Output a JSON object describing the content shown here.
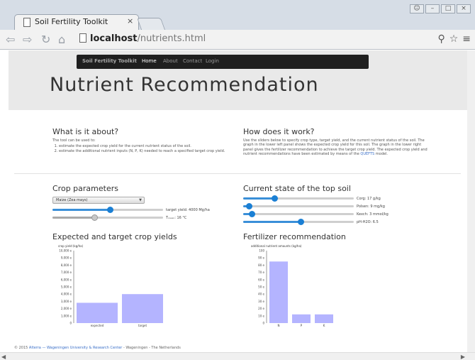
{
  "browser": {
    "tab_title": "Soil Fertility Toolkit",
    "tab_close": "×",
    "url_host": "localhost",
    "url_path": "/nutrients.html"
  },
  "site_nav": {
    "brand": "Soil Fertility Toolkit",
    "items": [
      "Home",
      "About",
      "Contact",
      "Login"
    ],
    "active_index": 0
  },
  "page_title": "Nutrient Recommendation",
  "about": {
    "heading": "What is it about?",
    "intro": "The tool can be used to:",
    "items": [
      "estimate the expected crop yield for the current nutrient status of the soil.",
      "estimate the additional nutrient inputs (N, P, K) needed to reach a specified target crop yield."
    ]
  },
  "how": {
    "heading": "How does it work?",
    "text": "Use the sliders below to specify crop type, target yield, and the current nutrient status of the soil. The graph in the lower left panel shows the expected crop yield for this soil. The graph in the lower right panel gives the fertilizer recommendation to achieve the target crop yield. The expected crop yield and nutrient recommendations have been estimated by means of the",
    "model_link": "QUEFTS",
    "text_end": "model."
  },
  "crop": {
    "heading": "Crop parameters",
    "select_value": "Maize (Zea mays)",
    "target_yield_label": "target yield: 4000 Mg/ha",
    "target_yield_fraction": 0.52,
    "tmean_label": "Tₘₑₐₙ: 16 °C",
    "tmean_fraction": 0.38
  },
  "soil": {
    "heading": "Current state of the top soil",
    "sliders": [
      {
        "label": "Corg: 17 g/kg",
        "fraction": 0.28
      },
      {
        "label": "Polsen: 9 mg/kg",
        "fraction": 0.05
      },
      {
        "label": "Kexch: 3 mmol/kg",
        "fraction": 0.08
      },
      {
        "label": "pH-H2O: 6.5",
        "fraction": 0.52
      }
    ]
  },
  "yields_panel": {
    "heading": "Expected and target crop yields"
  },
  "fert_panel": {
    "heading": "Fertilizer recommendation"
  },
  "chart_data": [
    {
      "type": "bar",
      "title": "Expected and target crop yields",
      "ylabel": "crop yield (kg/ha)",
      "categories": [
        "expected",
        "target"
      ],
      "values": [
        2800,
        4000
      ],
      "ylim": [
        0,
        10000
      ],
      "yticks": [
        "0",
        "1,000 e",
        "2,000 e",
        "3,000 e",
        "4,000 e",
        "5,000 e",
        "6,000 e",
        "7,000 e",
        "8,000 e",
        "9,000 e",
        "10,000 e"
      ],
      "bar_color": "#b4b4ff"
    },
    {
      "type": "bar",
      "title": "Fertilizer recommendation",
      "ylabel": "additional nutrient amounts (kg/ha)",
      "categories": [
        "N",
        "P",
        "K"
      ],
      "values": [
        85,
        12,
        12
      ],
      "ylim": [
        0,
        100
      ],
      "yticks": [
        "0",
        "10 e",
        "20 e",
        "30 e",
        "40 e",
        "50 e",
        "60 e",
        "70 e",
        "80 e",
        "90 e",
        "100"
      ],
      "bar_color": "#b4b4ff"
    }
  ],
  "footer": {
    "prefix": "© 2015",
    "link": "Alterra — Wageningen University & Research Center",
    "suffix": "- Wageningen - The Netherlands"
  }
}
